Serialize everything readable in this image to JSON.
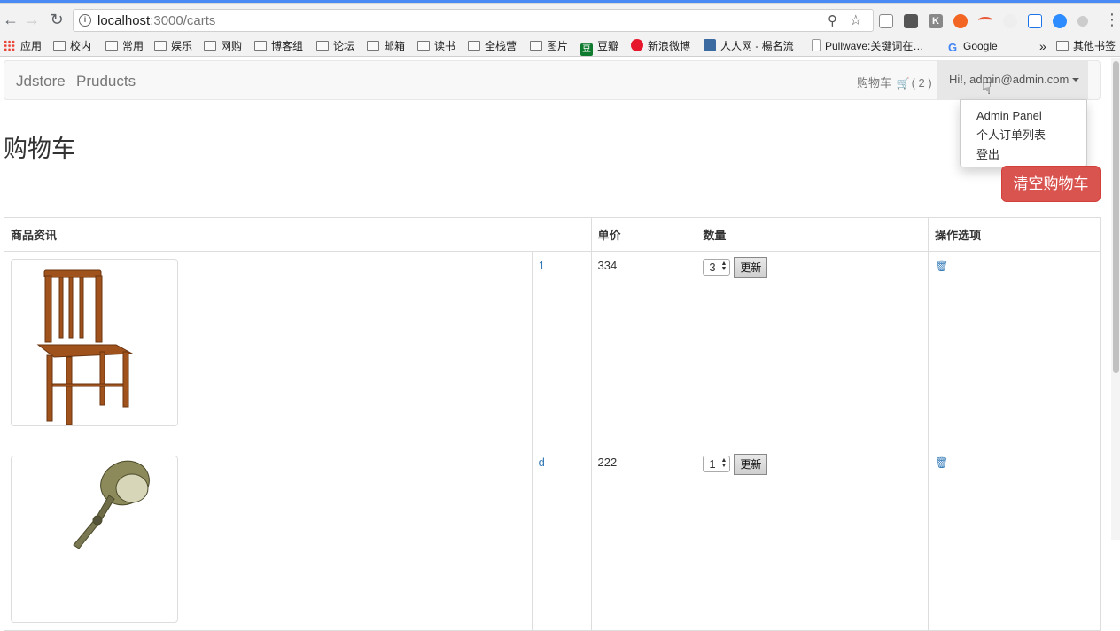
{
  "browser": {
    "url_host": "localhost",
    "url_path": ":3000/carts",
    "bookmarks": [
      {
        "label": "应用",
        "icon": "apps-grid-icon"
      },
      {
        "label": "校内",
        "icon": "folder-icon"
      },
      {
        "label": "常用",
        "icon": "folder-icon"
      },
      {
        "label": "娱乐",
        "icon": "folder-icon"
      },
      {
        "label": "网购",
        "icon": "folder-icon"
      },
      {
        "label": "博客组",
        "icon": "folder-icon"
      },
      {
        "label": "论坛",
        "icon": "folder-icon"
      },
      {
        "label": "邮箱",
        "icon": "folder-icon"
      },
      {
        "label": "读书",
        "icon": "folder-icon"
      },
      {
        "label": "全栈营",
        "icon": "folder-icon"
      },
      {
        "label": "图片",
        "icon": "folder-icon"
      },
      {
        "label": "豆瓣",
        "icon": "douban-icon"
      },
      {
        "label": "新浪微博",
        "icon": "weibo-icon"
      },
      {
        "label": "人人网 - 楊名流",
        "icon": "renren-icon"
      },
      {
        "label": "Pullwave:关键词在…",
        "icon": "page-icon"
      },
      {
        "label": "Google",
        "icon": "google-icon"
      },
      {
        "label": "其他书签",
        "icon": "folder-icon"
      }
    ],
    "overflow_chevron": "»"
  },
  "navbar": {
    "brand": "Jdstore",
    "products": "Pruducts",
    "cart_label": "购物车",
    "cart_count": "( 2 )",
    "user_label": "Hi!, admin@admin.com"
  },
  "dropdown": {
    "items": [
      "Admin Panel",
      "个人订单列表",
      "登出"
    ]
  },
  "page": {
    "title": "购物车",
    "clear_button": "清空购物车"
  },
  "table": {
    "headers": [
      "商品资讯",
      "单价",
      "数量",
      "操作选项"
    ],
    "rows": [
      {
        "name": "1",
        "price": "334",
        "qty": "3",
        "update": "更新",
        "image": "chair"
      },
      {
        "name": "d",
        "price": "222",
        "qty": "1",
        "update": "更新",
        "image": "lamp"
      }
    ]
  },
  "colors": {
    "danger": "#d9534f",
    "link": "#337ab7",
    "navbar_bg": "#f8f8f8"
  }
}
